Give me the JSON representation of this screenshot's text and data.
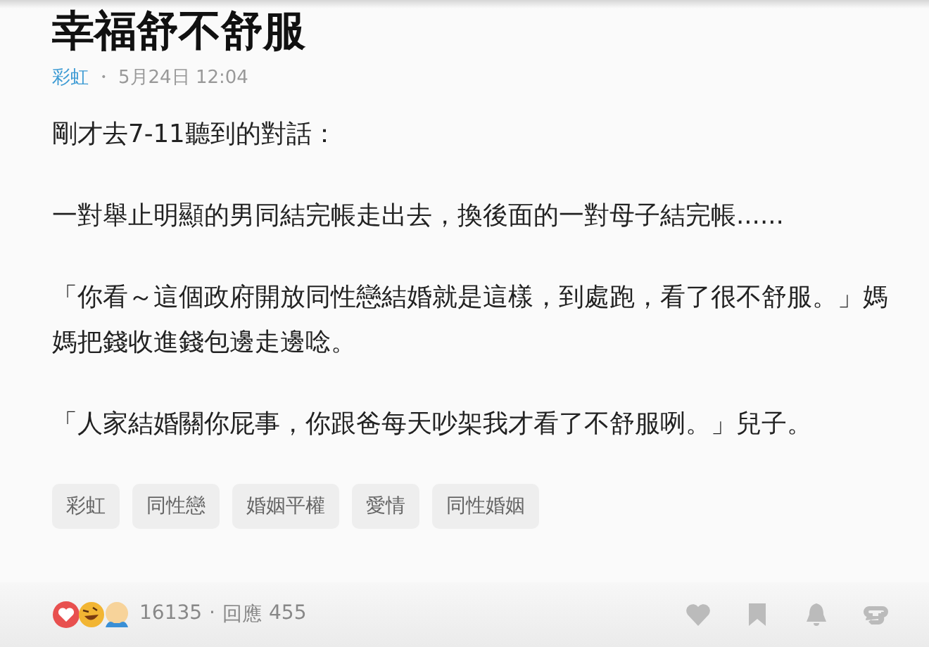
{
  "post": {
    "title": "幸福舒不舒服",
    "board": "彩虹",
    "separator": "・",
    "time": "5月24日 12:04"
  },
  "paragraphs": [
    "剛才去7-11聽到的對話：",
    "一對舉止明顯的男同結完帳走出去，換後面的一對母子結完帳......",
    "「你看～這個政府開放同性戀結婚就是這樣，到處跑，看了很不舒服。」媽媽把錢收進錢包邊走邊唸。",
    "「人家結婚關你屁事，你跟爸每天吵架我才看了不舒服咧。」兒子。"
  ],
  "tags": [
    "彩虹",
    "同性戀",
    "婚姻平權",
    "愛情",
    "同性婚姻"
  ],
  "footer": {
    "likes": "16135",
    "separator": "·",
    "reply_label": "回應",
    "replies": "455"
  }
}
